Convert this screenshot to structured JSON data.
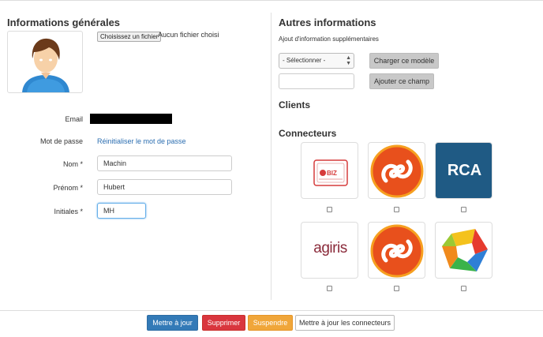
{
  "general": {
    "title": "Informations générales",
    "file_button": "Choisissez un fichier",
    "file_status": "Aucun fichier choisi",
    "email_label": "Email",
    "password_label": "Mot de passe",
    "reset_password_link": "Réinitialiser le mot de passe",
    "nom_label": "Nom *",
    "nom_value": "Machin",
    "prenom_label": "Prénom *",
    "prenom_value": "Hubert",
    "initiales_label": "Initiales *",
    "initiales_value": "MH"
  },
  "other": {
    "title": "Autres informations",
    "subtitle": "Ajout d'information supplémentaires",
    "select_value": "- Sélectionner -",
    "load_template_button": "Charger ce modèle",
    "add_field_button": "Ajouter ce champ",
    "clients_title": "Clients",
    "connectors_title": "Connecteurs"
  },
  "connectors": [
    {
      "name": "bizz-logo"
    },
    {
      "name": "orange-logo"
    },
    {
      "name": "rca-logo",
      "text": "RCA"
    },
    {
      "name": "agiris-logo",
      "text": "agiris"
    },
    {
      "name": "orange-logo"
    },
    {
      "name": "multicolor-logo"
    }
  ],
  "footer": {
    "update_button": "Mettre à jour",
    "delete_button": "Supprimer",
    "suspend_button": "Suspendre",
    "update_connectors_button": "Mettre à jour les connecteurs"
  },
  "colors": {
    "primary": "#337ab7",
    "danger": "#d9363e",
    "warning": "#f0a63a",
    "rca": "#1f5a84",
    "orange": "#e04a1a"
  }
}
